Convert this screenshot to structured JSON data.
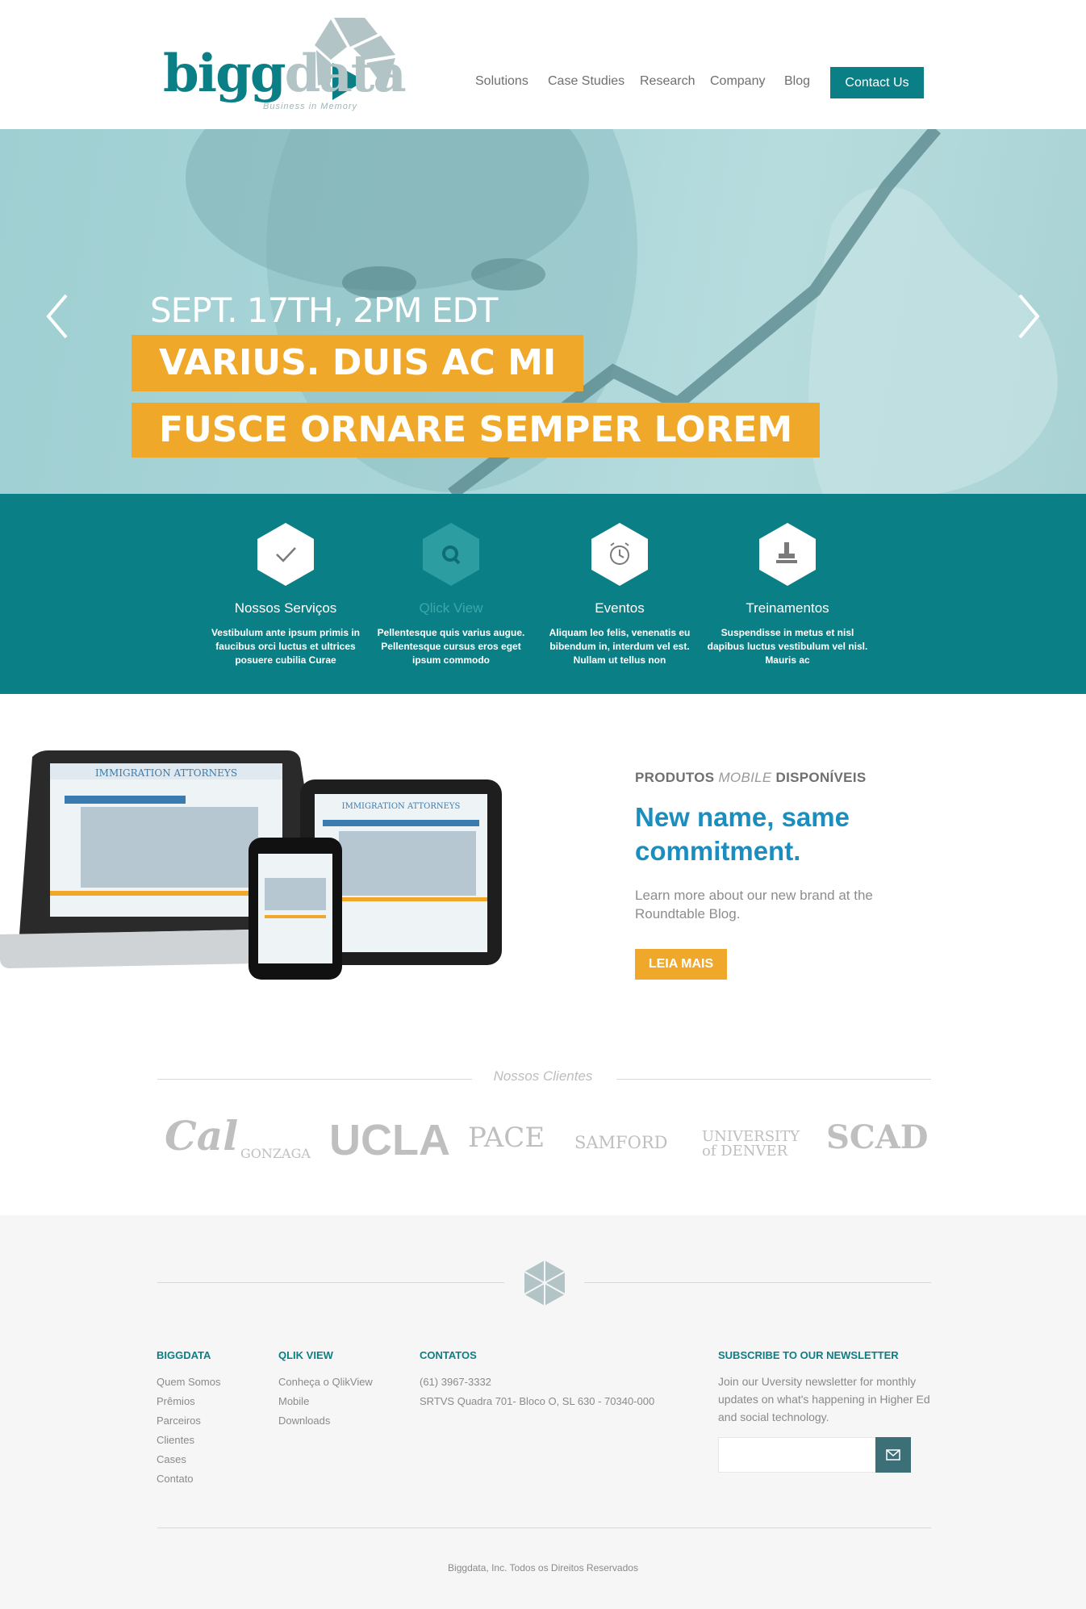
{
  "brand": {
    "logo_a": "bigg",
    "logo_b": "data",
    "tagline": "Business in Memory"
  },
  "nav": {
    "items": [
      "Solutions",
      "Case Studies",
      "Research",
      "Company",
      "Blog"
    ],
    "cta": "Contact Us"
  },
  "hero": {
    "date": "SEPT. 17TH, 2PM EDT",
    "line1": "VARIUS. DUIS AC MI",
    "line2": "FUSCE ORNARE SEMPER LOREM"
  },
  "features": [
    {
      "icon": "check-icon",
      "title": "Nossos Serviços",
      "desc": "Vestibulum ante ipsum primis in faucibus orci luctus et ultrices posuere cubilia Curae"
    },
    {
      "icon": "search-icon",
      "title": "Qlick View",
      "desc": "Pellentesque quis varius augue. Pellentesque cursus eros eget ipsum commodo"
    },
    {
      "icon": "alarm-clock-icon",
      "title": "Eventos",
      "desc": "Aliquam leo felis, venenatis eu bibendum in, interdum vel est. Nullam ut tellus non"
    },
    {
      "icon": "stamp-icon",
      "title": "Treinamentos",
      "desc": "Suspendisse in metus et nisl dapibus luctus vestibulum vel nisl. Mauris ac"
    }
  ],
  "product": {
    "label_a": "PRODUTOS",
    "label_b": "MOBILE",
    "label_c": "DISPONÍVEIS",
    "title": "New name, same commitment.",
    "text": "Learn more about our new brand at the Roundtable Blog.",
    "button": "LEIA MAIS",
    "screen_heading": "IMMIGRATION ATTORNEYS"
  },
  "clients": {
    "title": "Nossos Clientes",
    "logos": [
      "Cal",
      "GONZAGA",
      "UCLA",
      "PACE",
      "SAMFORD",
      "UNIVERSITY of DENVER",
      "SCAD"
    ]
  },
  "footer": {
    "col1": {
      "title": "BIGGDATA",
      "links": [
        "Quem Somos",
        "Prêmios",
        "Parceiros",
        "Clientes",
        "Cases",
        "Contato"
      ]
    },
    "col2": {
      "title": "QLIK VIEW",
      "links": [
        "Conheça o QlikView",
        "Mobile",
        "Downloads"
      ]
    },
    "col3": {
      "title": "CONTATOS",
      "lines": [
        "(61) 3967-3332",
        "SRTVS Quadra 701- Bloco O, SL 630 - 70340-000"
      ]
    },
    "newsletter": {
      "title": "SUBSCRIBE TO OUR NEWSLETTER",
      "text": "Join our Uversity newsletter for monthly updates on what's happening in Higher Ed and social technology.",
      "input_placeholder": ""
    },
    "copyright": "Biggdata, Inc. Todos os Direitos Reservados"
  },
  "colors": {
    "teal": "#0b7f86",
    "orange": "#f0a82b",
    "blue": "#1b8ec0"
  }
}
